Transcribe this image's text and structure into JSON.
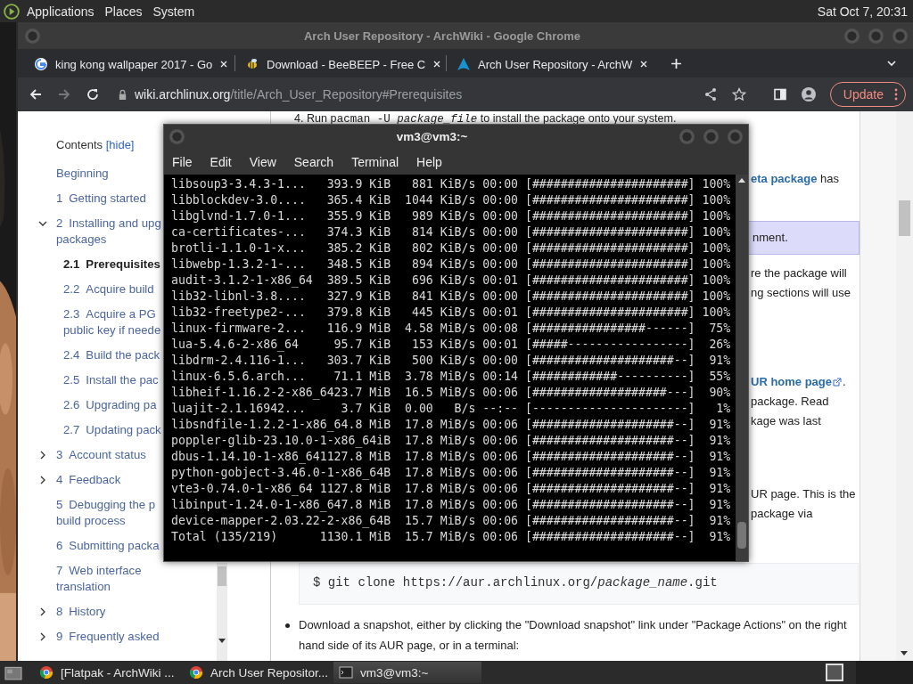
{
  "top_panel": {
    "menus": [
      "Applications",
      "Places",
      "System"
    ],
    "clock": "Sat Oct  7, 20:31"
  },
  "browser": {
    "title": "Arch User Repository - ArchWiki - Google Chrome",
    "tabs": [
      {
        "title": "king kong wallpaper 2017 - Go",
        "kind": "google"
      },
      {
        "title": "Download - BeeBEEP - Free C",
        "kind": "bee"
      },
      {
        "title": "Arch User Repository - ArchW",
        "kind": "arch"
      }
    ],
    "nav": {
      "back_disabled": false,
      "forward_disabled": true
    },
    "address": {
      "host": "wiki.archlinux.org",
      "path": "/title/Arch_User_Repository#Prerequisites"
    },
    "update_button": "Update"
  },
  "toc": {
    "heading": "Contents",
    "toggle": "[hide]",
    "items": [
      {
        "label": [
          "Beginning"
        ],
        "selected": false
      },
      {
        "number": "1",
        "label": [
          "Getting started"
        ],
        "selected": false
      },
      {
        "number": "2",
        "label": [
          "Installing and upg",
          "packages"
        ],
        "selected": false,
        "expanded": true,
        "children": [
          {
            "number": "2.1",
            "label": [
              "Prerequisites"
            ],
            "selected": true
          },
          {
            "number": "2.2",
            "label": [
              "Acquire build"
            ],
            "selected": false
          },
          {
            "number": "2.3",
            "label": [
              "Acquire a PG",
              "public key if neede"
            ],
            "selected": false
          },
          {
            "number": "2.4",
            "label": [
              "Build the pack"
            ],
            "selected": false
          },
          {
            "number": "2.5",
            "label": [
              "Install the pac"
            ],
            "selected": false
          },
          {
            "number": "2.6",
            "label": [
              "Upgrading pa"
            ],
            "selected": false
          },
          {
            "number": "2.7",
            "label": [
              "Updating pack"
            ],
            "selected": false
          }
        ]
      },
      {
        "number": "3",
        "label": [
          "Account status"
        ],
        "selected": false,
        "expanded": false
      },
      {
        "number": "4",
        "label": [
          "Feedback"
        ],
        "selected": false,
        "expanded": false
      },
      {
        "number": "5",
        "label": [
          "Debugging the p",
          "build process"
        ],
        "selected": false
      },
      {
        "number": "6",
        "label": [
          "Submitting packa"
        ],
        "selected": false
      },
      {
        "number": "7",
        "label": [
          "Web interface",
          "translation"
        ],
        "selected": false
      },
      {
        "number": "8",
        "label": [
          "History"
        ],
        "selected": false,
        "expanded": false
      },
      {
        "number": "9",
        "label": [
          "Frequently asked"
        ],
        "selected": false,
        "expanded": false
      }
    ]
  },
  "article": {
    "step": {
      "number": "4.",
      "before": "Run",
      "code": "pacman -U *package_file*",
      "after": "to install the package onto your system."
    },
    "fragments": [
      {
        "kind": "link",
        "link": "eta package",
        "text": " has"
      },
      {
        "kind": "note",
        "text": "nment."
      },
      {
        "kind": "text",
        "text": "re the package will"
      },
      {
        "kind": "text",
        "text": "ng sections will use"
      },
      {
        "kind": "external_link",
        "link": "UR home page",
        "text": "."
      },
      {
        "kind": "text",
        "text": "package. Read"
      },
      {
        "kind": "text",
        "text": "kage was last"
      },
      {
        "kind": "text",
        "text": "UR page. This is the"
      },
      {
        "kind": "text",
        "text": "package via"
      }
    ],
    "code": "$ git clone https://aur.archlinux.org/*package_name*.git",
    "bullet": "Download a snapshot, either by clicking the \"Download snapshot\" link under \"Package Actions\" on the right hand side of its AUR page, or in a terminal:"
  },
  "terminal": {
    "title": "vm3@vm3:~",
    "menus": [
      "File",
      "Edit",
      "View",
      "Search",
      "Terminal",
      "Help"
    ],
    "lines": [
      "libsoup3-3.4.3-1...   393.9 KiB   881 KiB/s 00:00 [######################] 100%",
      "libblockdev-3.0....   365.4 KiB  1044 KiB/s 00:00 [######################] 100%",
      "libglvnd-1.7.0-1...   355.9 KiB   989 KiB/s 00:00 [######################] 100%",
      "ca-certificates-...   374.3 KiB   814 KiB/s 00:00 [######################] 100%",
      "brotli-1.1.0-1-x...   385.2 KiB   802 KiB/s 00:00 [######################] 100%",
      "libwebp-1.3.2-1-...   348.5 KiB   894 KiB/s 00:00 [######################] 100%",
      "audit-3.1.2-1-x86_64  389.5 KiB   696 KiB/s 00:01 [######################] 100%",
      "lib32-libnl-3.8....   327.9 KiB   841 KiB/s 00:00 [######################] 100%",
      "lib32-freetype2-...   379.8 KiB   445 KiB/s 00:01 [######################] 100%",
      "linux-firmware-2...   116.9 MiB  4.58 MiB/s 00:08 [################------]  75%",
      "lua-5.4.6-2-x86_64     95.7 KiB   153 KiB/s 00:01 [#####-----------------]  26%",
      "libdrm-2.4.116-1...   303.7 KiB   500 KiB/s 00:00 [####################--]  91%",
      "linux-6.5.6.arch...    71.1 MiB  3.78 MiB/s 00:14 [############----------]  55%",
      "libheif-1.16.2-2-x86_6423.7 MiB  16.5 MiB/s 00:06 [###################---]  90%",
      "luajit-2.1.16942...     3.7 KiB  0.00   B/s --:-- [----------------------]   1%",
      "libsndfile-1.2.2-1-x86_64.8 MiB  17.8 MiB/s 00:06 [####################--]  91%",
      "poppler-glib-23.10.0-1-x86_64iB  17.8 MiB/s 00:06 [####################--]  91%",
      "dbus-1.14.10-1-x86_641127.8 MiB  17.8 MiB/s 00:06 [####################--]  91%",
      "python-gobject-3.46.0-1-x86_64B  17.8 MiB/s 00:06 [####################--]  91%",
      "vte3-0.74.0-1-x86_64 1127.8 MiB  17.8 MiB/s 00:06 [####################--]  91%",
      "libinput-1.24.0-1-x86_647.8 MiB  17.8 MiB/s 00:06 [####################--]  91%",
      "device-mapper-2.03.22-2-x86_64B  15.7 MiB/s 00:06 [####################--]  91%",
      "Total (135/219)      1130.1 MiB  15.7 MiB/s 00:06 [####################--]  91%"
    ]
  },
  "taskbar": {
    "tasks": [
      {
        "title": "[Flatpak - ArchWiki ...",
        "kind": "chrome",
        "selected": false
      },
      {
        "title": "Arch User Repositor...",
        "kind": "chrome",
        "selected": false
      },
      {
        "title": "vm3@vm3:~",
        "kind": "terminal",
        "selected": true
      }
    ]
  }
}
